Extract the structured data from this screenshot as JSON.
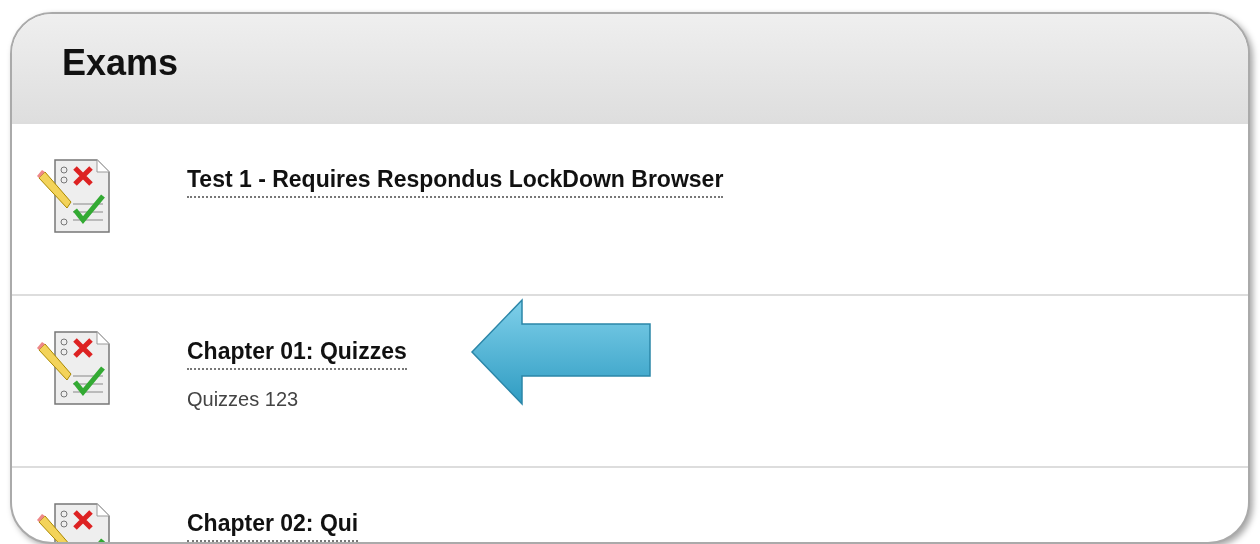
{
  "section": {
    "title": "Exams"
  },
  "items": [
    {
      "title": "Test 1 - Requires Respondus LockDown Browser"
    },
    {
      "title": "Chapter 01: Quizzes",
      "description": "Quizzes 123",
      "highlighted": true
    },
    {
      "title": "Chapter 02: Qui"
    }
  ]
}
